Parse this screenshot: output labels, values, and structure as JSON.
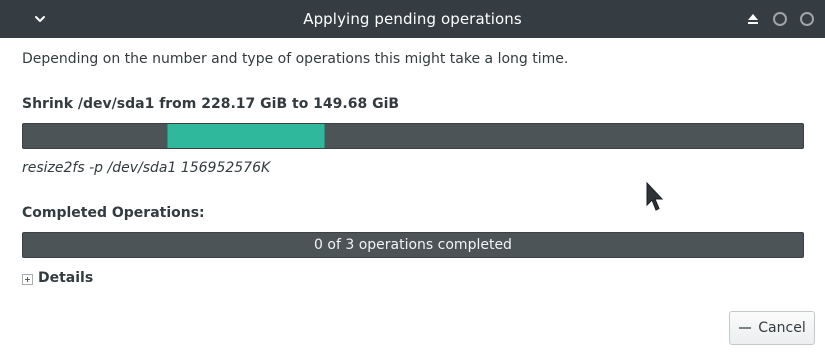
{
  "window": {
    "title": "Applying pending operations"
  },
  "main": {
    "description": "Depending on the number and type of operations this might take a long time.",
    "current_operation": {
      "title": "Shrink /dev/sda1 from 228.17 GiB to 149.68 GiB",
      "progress_start_fraction": 0.184,
      "progress_end_fraction": 0.384,
      "command": "resize2fs -p /dev/sda1 156952576K"
    },
    "completed": {
      "title": "Completed Operations:",
      "progress_text": "0 of 3 operations completed",
      "done": 0,
      "total": 3
    },
    "details_label": "Details"
  },
  "footer": {
    "cancel_label": "Cancel"
  },
  "colors": {
    "titlebar": "#353d42",
    "progress_trough": "#4c5458",
    "progress_fill": "#2fb89b"
  },
  "icons": {
    "menu": "chevron-down-icon",
    "eject": "eject-icon",
    "minimize": "circle-icon",
    "maximize": "circle-icon",
    "details": "plus-box-icon",
    "cancel": "minus-icon"
  }
}
